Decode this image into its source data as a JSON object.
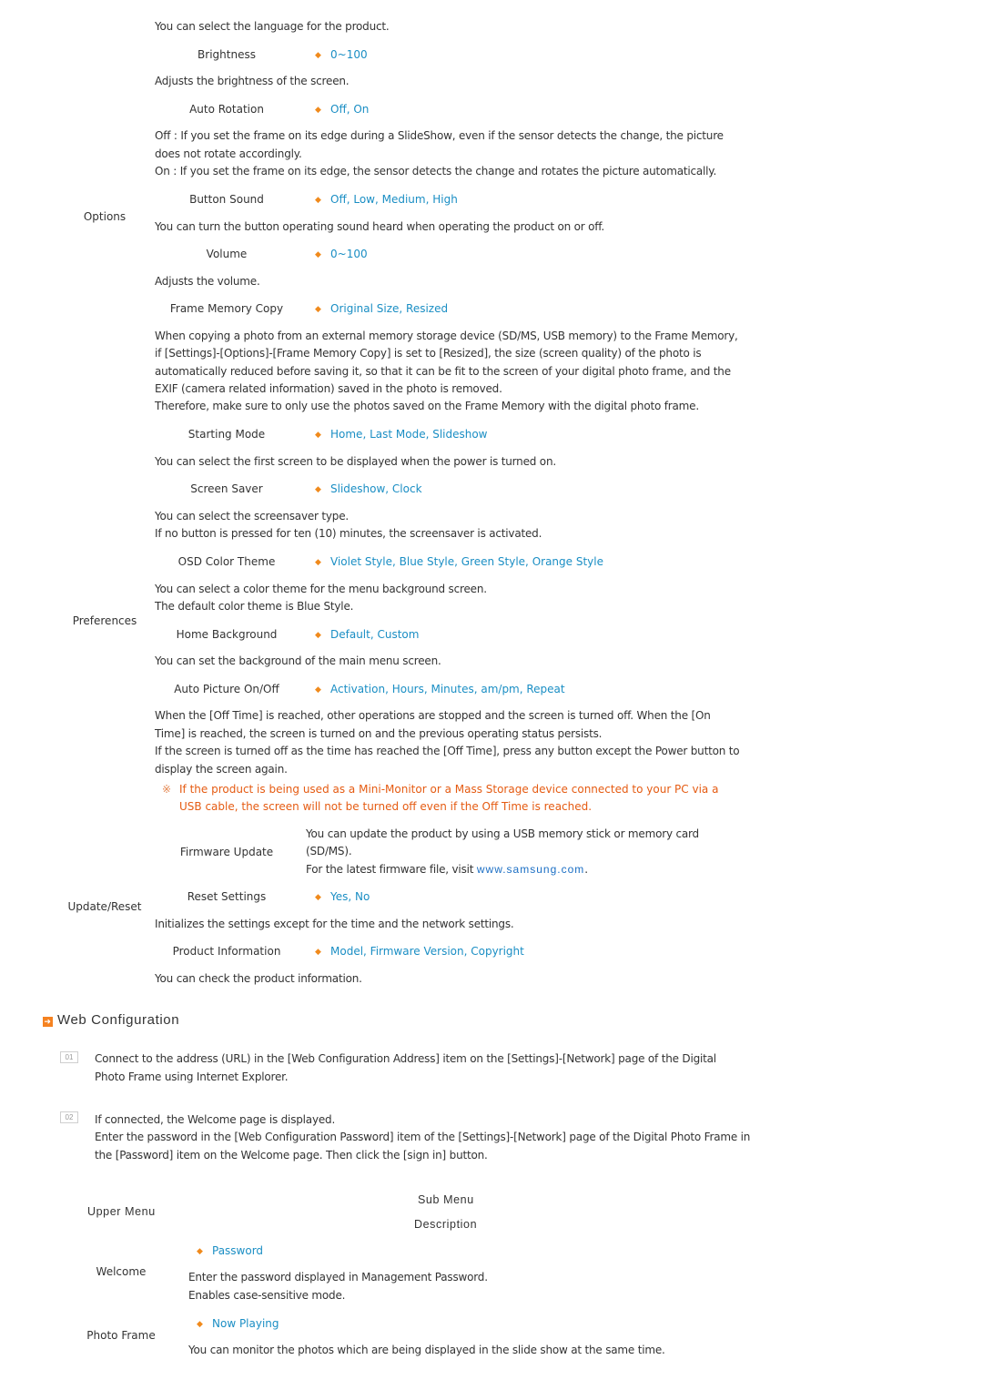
{
  "colors": {
    "text": "#333333",
    "option": "#1a8ec4",
    "bullet": "#f08a1c",
    "note": "#e55b12",
    "link": "#1a6ec4",
    "section_icon": "#f58220"
  },
  "intro_text": "You can select the language for the product.",
  "categories": {
    "options": "Options",
    "preferences": "Preferences",
    "update_reset": "Update/Reset"
  },
  "settings": {
    "brightness": {
      "label": "Brightness",
      "options": "0~100",
      "desc": [
        "Adjusts the brightness of the screen."
      ]
    },
    "auto_rotation": {
      "label": "Auto Rotation",
      "options": "Off, On",
      "desc": [
        "Off : If you set the frame on its edge during a SlideShow, even if the sensor detects the change, the picture",
        "does not rotate accordingly.",
        "On : If you set the frame on its edge, the sensor detects the change and rotates the picture automatically."
      ]
    },
    "button_sound": {
      "label": "Button Sound",
      "options": "Off, Low, Medium, High",
      "desc": [
        "You can turn the button operating sound heard when operating the product on or off."
      ]
    },
    "volume": {
      "label": "Volume",
      "options": "0~100",
      "desc": [
        "Adjusts the volume."
      ]
    },
    "frame_memory_copy": {
      "label": "Frame Memory Copy",
      "options": "Original Size, Resized",
      "desc": [
        "When copying a photo from an external memory storage device (SD/MS, USB memory) to the Frame Memory,",
        "if [Settings]-[Options]-[Frame Memory Copy] is set to [Resized], the size (screen quality) of the photo is",
        "automatically reduced before saving it, so that it can be fit to the screen of your digital photo frame, and the",
        "EXIF (camera related information) saved in the photo is removed.",
        "Therefore, make sure to only use the photos saved on the Frame Memory with the digital photo frame."
      ]
    },
    "starting_mode": {
      "label": "Starting Mode",
      "options": "Home, Last Mode, Slideshow",
      "desc": [
        "You can select the first screen to be displayed when the power is turned on."
      ]
    },
    "screen_saver": {
      "label": "Screen Saver",
      "options": "Slideshow, Clock",
      "desc": [
        "You can select the screensaver type.",
        "If no button is pressed for ten (10) minutes, the screensaver is activated."
      ]
    },
    "osd_color_theme": {
      "label": "OSD Color Theme",
      "options": "Violet Style, Blue Style, Green Style, Orange Style",
      "desc": [
        "You can select a color theme for the menu background screen.",
        "The default color theme is Blue Style."
      ]
    },
    "home_background": {
      "label": "Home Background",
      "options": "Default, Custom",
      "desc": [
        "You can set the background of the main menu screen."
      ]
    },
    "auto_picture": {
      "label": "Auto Picture On/Off",
      "options": "Activation, Hours, Minutes, am/pm, Repeat",
      "desc": [
        "When the [Off Time] is reached, other operations are stopped and the screen is turned off. When the [On",
        "Time] is reached, the screen is turned on and the previous operating status persists.",
        "If the screen is turned off as the time has reached the [Off Time], press any button except the Power button to",
        "display the screen again."
      ],
      "note_mark": "※",
      "note": [
        "If the product is being used as a Mini-Monitor or a Mass Storage device connected to your PC via a",
        "USB cable, the screen will not be turned off even if the Off Time is reached."
      ]
    },
    "firmware_update": {
      "label": "Firmware Update",
      "desc": [
        "You can update the product by using a USB memory stick or memory card",
        "(SD/MS)."
      ],
      "desc_prefix": "For the latest firmware file, visit ",
      "link": "www.samsung.com",
      "desc_suffix": "."
    },
    "reset_settings": {
      "label": "Reset Settings",
      "options": "Yes, No",
      "desc": [
        "Initializes the settings except for the time and the network settings."
      ]
    },
    "product_information": {
      "label": "Product Information",
      "options": "Model, Firmware Version, Copyright",
      "desc": [
        "You can check the product information."
      ]
    }
  },
  "bullet_icon": "diamond-bullet",
  "web_config": {
    "title": "Web Configuration",
    "icon": "arrow-right-square",
    "steps": [
      {
        "num": "01",
        "lines": [
          "Connect to the address (URL) in the [Web Configuration Address] item on the [Settings]-[Network] page of the Digital",
          "Photo Frame using Internet Explorer."
        ]
      },
      {
        "num": "02",
        "lines": [
          "If connected, the Welcome page is displayed.",
          "Enter the password in the [Web Configuration Password] item of the [Settings]-[Network] page of the Digital Photo Frame in",
          "the [Password] item on the Welcome page. Then click the [sign in] button."
        ]
      }
    ],
    "table": {
      "headers": {
        "upper": "Upper Menu",
        "sub": "Sub Menu",
        "desc": "Description"
      },
      "rows": [
        {
          "upper": "Welcome",
          "sub": "Password",
          "desc": [
            "Enter the password displayed in Management Password.",
            "Enables case-sensitive mode."
          ]
        },
        {
          "upper": "Photo Frame",
          "sub": "Now Playing",
          "desc": [
            "You can monitor the photos which are being displayed in the slide show at the same time."
          ]
        }
      ]
    }
  }
}
